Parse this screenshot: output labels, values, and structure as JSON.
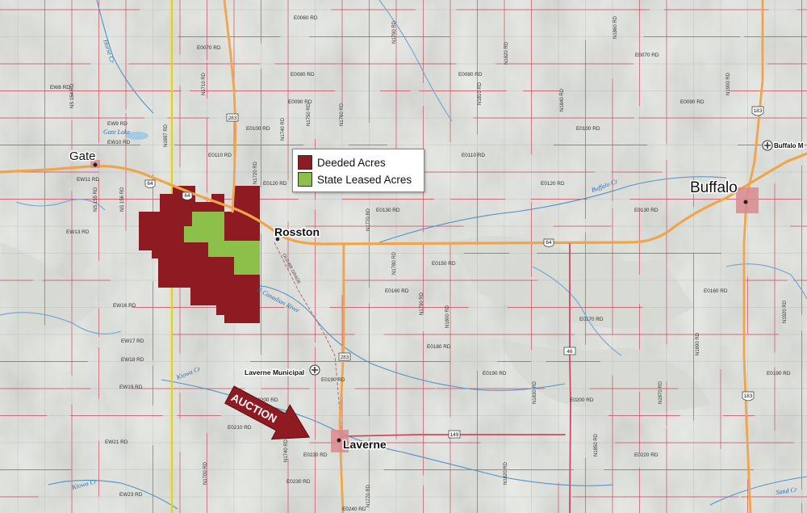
{
  "colors": {
    "deeded": "#8e1a22",
    "state_leased": "#8cc04a",
    "highway": "#f0a54a",
    "section_road": "#d1485e",
    "county_line": "#e8d400",
    "water": "#4f93c9"
  },
  "legend": {
    "deeded_label": "Deeded Acres",
    "state_label": "State Leased Acres"
  },
  "towns": {
    "gate": "Gate",
    "rosston": "Rosston",
    "buffalo": "Buffalo",
    "laverne": "Laverne",
    "buffalo_airport": "Buffalo M",
    "laverne_airport": "Laverne Municipal"
  },
  "callout": {
    "auction": "AUCTION"
  },
  "highways": {
    "us64_a": "64",
    "us64_b": "64",
    "us64_c": "64",
    "sh283_a": "283",
    "sh283_b": "283",
    "us183_a": "183",
    "us183_b": "183",
    "sh149": "149",
    "sh46": "46"
  },
  "water_labels": {
    "buffalo_cr": "Buffalo Cr",
    "canadian_river": "N Canadian River",
    "kiowa_cr": "Kiowa Cr",
    "kiowa_cr2": "Kiowa Cr",
    "sand_cr": "Sand Cr",
    "horse_cr": "Horse Cr",
    "gate_lake": "Gate Lake"
  },
  "rail_label": "OLD RR GRADE",
  "road_labels": {
    "ew_top": [
      "E0060 RD",
      "E0070 RD",
      "E0080 RD",
      "E0090 RD",
      "E0100 RD",
      "E0110 RD",
      "E0120 RD",
      "E0130 RD",
      "E0150 RD",
      "E0160 RD",
      "E0170 RD",
      "E0180 RD",
      "E0190 RD",
      "E0200 RD",
      "E0210 RD",
      "E0220 RD",
      "E0230 RD",
      "E0240 RD"
    ],
    "ew_west": [
      "EW8 RD",
      "EW9 RD",
      "EW10 RD",
      "EW11 RD",
      "EW13 RD",
      "EW16 RD",
      "EW17 RD",
      "EW18 RD",
      "EW19 RD",
      "EW21 RD",
      "EW23 RD"
    ],
    "ns": [
      "N1700 RD",
      "N1710 RD",
      "N1720 RD",
      "N1730 RD",
      "N1740 RD",
      "N1750 RD",
      "N1760 RD",
      "N1770 RD",
      "N1780 RD",
      "N1790 RD",
      "N1800 RD",
      "N1810 RD",
      "N1820 RD",
      "N1830 RD",
      "N1840 RD",
      "N1850 RD",
      "N1860 RD",
      "N1870 RD",
      "N1880 RD",
      "N1890 RD",
      "N1900 RD",
      "N1910 RD",
      "N1920 RD",
      "N1697 RD",
      "NS 154 RD",
      "NS 155 RD",
      "NS 156 RD"
    ]
  }
}
